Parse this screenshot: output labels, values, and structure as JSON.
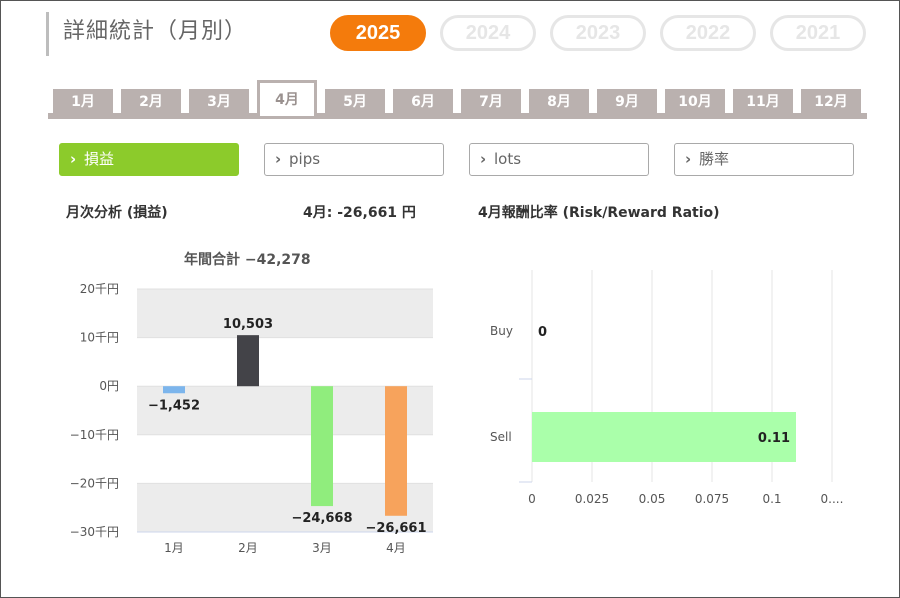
{
  "header": {
    "title": "詳細統計（月別）"
  },
  "years": [
    "2025",
    "2024",
    "2023",
    "2022",
    "2021"
  ],
  "active_year": "2025",
  "months": [
    "1月",
    "2月",
    "3月",
    "4月",
    "5月",
    "6月",
    "7月",
    "8月",
    "9月",
    "10月",
    "11月",
    "12月"
  ],
  "active_month_index": 3,
  "metrics": [
    {
      "label": "損益",
      "active": true
    },
    {
      "label": "pips",
      "active": false
    },
    {
      "label": "lots",
      "active": false
    },
    {
      "label": "勝率",
      "active": false
    }
  ],
  "analysis": {
    "title": "月次分析 (損益)",
    "month_summary": "4月:  -26,661 円",
    "ratio_title": "4月報酬比率 (Risk/Reward Ratio)",
    "annual_total": "年間合計 −42,278"
  },
  "colors": {
    "accent_orange": "#f47b0c",
    "accent_green": "#8ccb2b",
    "tab_gray": "#bab1af"
  },
  "chart_data": [
    {
      "type": "bar",
      "categories": [
        "1月",
        "2月",
        "3月",
        "4月"
      ],
      "values": [
        -1452,
        10503,
        -24668,
        -26661
      ],
      "data_labels": [
        "−1,452",
        "10,503",
        "−24,668",
        "−26,661"
      ],
      "bar_colors": [
        "#7cb5ec",
        "#434348",
        "#90ed7d",
        "#f7a35c"
      ],
      "y_ticks": [
        20000,
        10000,
        0,
        -10000,
        -20000,
        -30000
      ],
      "y_tick_labels": [
        "20千円",
        "10千円",
        "0円",
        "−10千円",
        "−20千円",
        "−30千円"
      ],
      "ylim": [
        -30000,
        20000
      ],
      "grid": "alternating bands"
    },
    {
      "type": "bar",
      "orientation": "horizontal",
      "categories": [
        "Buy",
        "Sell"
      ],
      "values": [
        0,
        0.11
      ],
      "data_labels": [
        "0",
        "0.11"
      ],
      "bar_color": "#aaffaa",
      "x_ticks": [
        0,
        0.025,
        0.05,
        0.075,
        0.1,
        0.125
      ],
      "x_tick_labels": [
        "0",
        "0.025",
        "0.05",
        "0.075",
        "0.1",
        "0...."
      ],
      "xlim": [
        0,
        0.125
      ],
      "grid": true
    }
  ]
}
